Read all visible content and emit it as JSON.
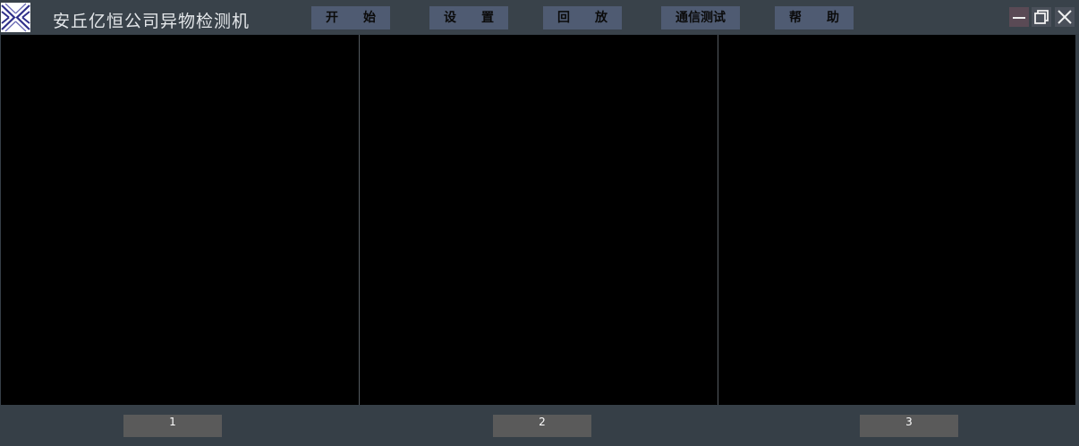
{
  "app": {
    "title": "安丘亿恒公司异物检测机"
  },
  "nav": {
    "start": "开　　始",
    "settings": "设　　置",
    "playback": "回　　放",
    "comm_test": "通信测试",
    "help": "帮　　助"
  },
  "window_controls": {
    "minimize_icon": "minimize-icon",
    "restore_icon": "restore-icon",
    "close_icon": "close-icon"
  },
  "panels": {
    "labels": [
      "1",
      "2",
      "3"
    ]
  },
  "colors": {
    "title_bar": "#39424a",
    "nav_button": "#4f5b72",
    "view_background": "#000000",
    "label_background": "#5a5a5a",
    "body_background": "#363f47"
  }
}
